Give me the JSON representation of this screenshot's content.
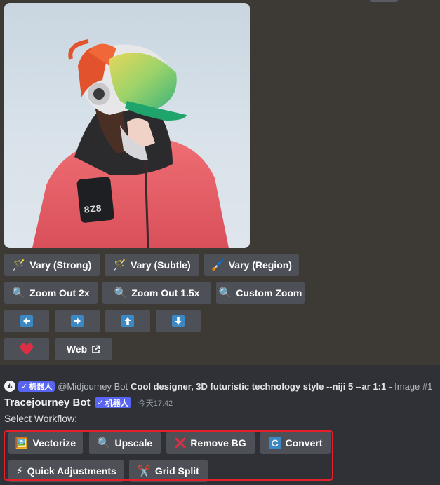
{
  "image": {
    "label": "8Z8"
  },
  "buttons_row1": [
    {
      "icon": "magic-wand-icon",
      "label": "Vary (Strong)"
    },
    {
      "icon": "magic-wand-icon",
      "label": "Vary (Subtle)"
    },
    {
      "icon": "paintbrush-icon",
      "label": "Vary (Region)"
    }
  ],
  "buttons_row2": [
    {
      "icon": "magnifier-icon",
      "label": "Zoom Out 2x"
    },
    {
      "icon": "magnifier-icon",
      "label": "Zoom Out 1.5x"
    },
    {
      "icon": "magnifier-icon",
      "label": "Custom Zoom"
    }
  ],
  "buttons_row3": [
    {
      "icon": "arrow-left-icon"
    },
    {
      "icon": "arrow-right-icon"
    },
    {
      "icon": "arrow-up-icon"
    },
    {
      "icon": "arrow-down-icon"
    }
  ],
  "buttons_row4": {
    "like_icon": "heart-icon",
    "web_label": "Web",
    "web_icon": "external-link-icon"
  },
  "reply_reference": {
    "bot_tag": "机器人",
    "author": "@Midjourney Bot",
    "prompt": "Cool designer, 3D futuristic technology style --niji 5 --ar 1:1",
    "suffix": "- Image #1"
  },
  "message": {
    "author": "Tracejourney Bot",
    "bot_tag": "机器人",
    "timestamp": "今天17:42",
    "text": "Select Workflow:"
  },
  "workflow_buttons": [
    {
      "icon": "picture-icon",
      "label": "Vectorize"
    },
    {
      "icon": "magnifier-icon",
      "label": "Upscale"
    },
    {
      "icon": "cross-mark-icon",
      "label": "Remove BG"
    },
    {
      "icon": "refresh-icon",
      "label": "Convert"
    },
    {
      "icon": "lightning-icon",
      "label": "Quick Adjustments"
    },
    {
      "icon": "scissors-icon",
      "label": "Grid Split"
    }
  ],
  "colors": {
    "upper_background": "#3d3935",
    "lower_background": "#2f3136",
    "button": "#4e5058",
    "bot_tag": "#5865f2",
    "highlight": "#e5202b",
    "arrow_button_icon": "#3b88c3"
  }
}
